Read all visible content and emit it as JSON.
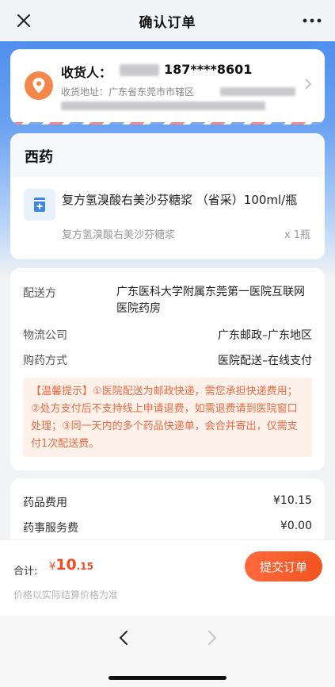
{
  "nav": {
    "title": "确认订单",
    "close_icon": "close-icon",
    "more_icon": "more-icon"
  },
  "address": {
    "name_label": "收货人：",
    "phone": "187****8601",
    "addr_label": "收货地址：",
    "addr_text": "广东省东莞市市辖区",
    "icon": "location-pin-icon",
    "accent": "#f4874b"
  },
  "medicine": {
    "section_title": "西药",
    "name": "复方氢溴酸右美沙芬糖浆 （省采）100ml/瓶",
    "generic_name": "复方氢溴酸右美沙芬糖浆",
    "quantity": "x 1瓶"
  },
  "info": {
    "delivery_label": "配送方",
    "delivery_value": "广东医科大学附属东莞第一医院互联网医院药房",
    "logistics_label": "物流公司",
    "logistics_value": "广东邮政–广东地区",
    "method_label": "购药方式",
    "method_value": "医院配送–在线支付",
    "notice": "【温馨提示】①医院配送为邮政快递，需您承担快递费用；②处方支付后不支持线上申请退费，如需退费请到医院窗口处理；③同一天内的多个药品快递单，会合并寄出，仅需支付1次配送费。"
  },
  "fees": {
    "drug_label": "药品费用",
    "drug_value": "¥10.15",
    "service_label": "药事服务费",
    "service_value": "¥0.00"
  },
  "footer": {
    "total_label": "合计:",
    "currency": "¥",
    "total_int": "10",
    "total_dec": ".15",
    "disclaimer": "价格以实际结算价格为准",
    "submit": "提交订单"
  },
  "colors": {
    "primary_blue": "#4f8ff0",
    "accent_orange": "#f3531f",
    "notice_bg": "#fdf1e9"
  }
}
